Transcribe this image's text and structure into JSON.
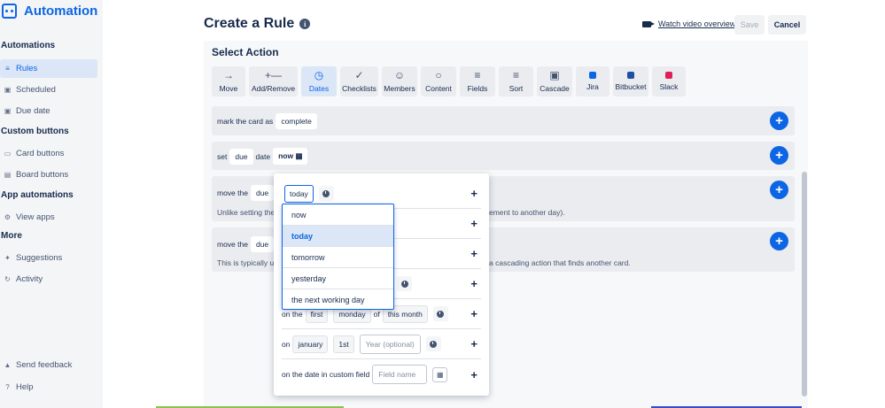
{
  "sidebar": {
    "title": "Automation",
    "sections": [
      {
        "heading": "Automations",
        "items": [
          {
            "label": "Rules",
            "icon": "sliders-icon",
            "active": true
          },
          {
            "label": "Scheduled",
            "icon": "calendar-icon"
          },
          {
            "label": "Due date",
            "icon": "calendar-clock-icon"
          }
        ]
      },
      {
        "heading": "Custom buttons",
        "items": [
          {
            "label": "Card buttons",
            "icon": "card-icon"
          },
          {
            "label": "Board buttons",
            "icon": "board-icon"
          }
        ]
      },
      {
        "heading": "App automations",
        "items": [
          {
            "label": "View apps",
            "icon": "gear-icon"
          }
        ]
      },
      {
        "heading": "More",
        "items": [
          {
            "label": "Suggestions",
            "icon": "sparkle-icon"
          },
          {
            "label": "Activity",
            "icon": "refresh-icon"
          }
        ]
      }
    ],
    "footer": [
      {
        "label": "Send feedback",
        "icon": "megaphone-icon"
      },
      {
        "label": "Help",
        "icon": "question-icon"
      }
    ]
  },
  "header": {
    "title": "Create a Rule",
    "watch_label": "Watch video overview",
    "save_label": "Save",
    "cancel_label": "Cancel"
  },
  "main": {
    "section_title": "Select Action",
    "tabs": [
      {
        "label": "Move",
        "icon": "arrow-right-icon"
      },
      {
        "label": "Add/Remove",
        "icon": "plus-minus-icon"
      },
      {
        "label": "Dates",
        "icon": "clock-icon",
        "active": true
      },
      {
        "label": "Checklists",
        "icon": "check-icon"
      },
      {
        "label": "Members",
        "icon": "person-icon"
      },
      {
        "label": "Content",
        "icon": "speech-bubble-icon"
      },
      {
        "label": "Fields",
        "icon": "lines-icon"
      },
      {
        "label": "Sort",
        "icon": "sort-icon"
      },
      {
        "label": "Cascade",
        "icon": "briefcase-icon"
      },
      {
        "label": "Jira",
        "icon": "jira-icon"
      },
      {
        "label": "Bitbucket",
        "icon": "bitbucket-icon"
      },
      {
        "label": "Slack",
        "icon": "slack-icon"
      }
    ],
    "card1": {
      "prefix": "mark the card as",
      "value": "complete"
    },
    "card2": {
      "w1": "set",
      "w2": "due",
      "w3": "date",
      "w4": "now"
    },
    "card3": {
      "w1": "move the",
      "w2": "due",
      "desc_left": "Unlike setting the",
      "desc_right": "ement to another day)."
    },
    "card4": {
      "w1": "move the",
      "w2": "due",
      "desc_left": "This is typically u",
      "desc_right": "a cascading action that finds another card."
    }
  },
  "popover": {
    "selected_value": "today",
    "row_on_the": {
      "w1": "on the",
      "w2": "first",
      "w3": "monday",
      "w4": "of",
      "w5": "this month"
    },
    "row_on": {
      "w1": "on",
      "w2": "january",
      "w3": "1st",
      "placeholder": "Year (optional)"
    },
    "row_custom": {
      "label": "on the date in custom field",
      "placeholder": "Field name"
    }
  },
  "dropdown": {
    "options": [
      "now",
      "today",
      "tomorrow",
      "yesterday",
      "the next working day"
    ],
    "selected": "today"
  },
  "colors": {
    "accent": "#0c66e4",
    "sidebar_bg": "#f4f5f7",
    "card_bg": "#ebecf0"
  }
}
